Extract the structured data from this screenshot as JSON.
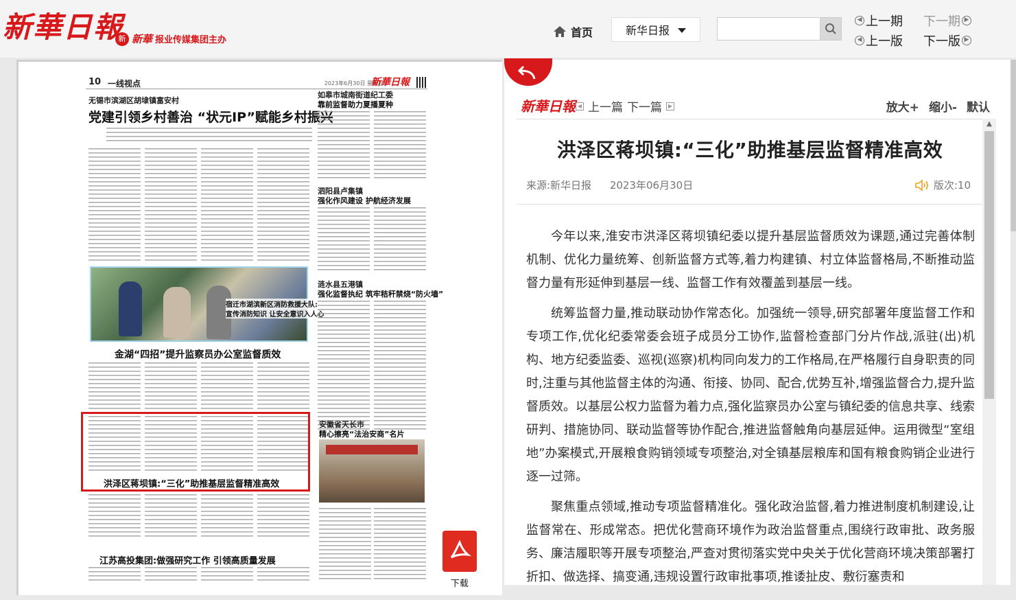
{
  "header": {
    "logo": "新華日報",
    "group_emblem": "新",
    "group_brand": "新華",
    "group_host": "报业传媒集团主办",
    "home_label": "首页",
    "paper_select": "新华日报",
    "search_placeholder": "",
    "prev_issue": "上一期",
    "next_issue": "下一期",
    "prev_page": "上一版",
    "next_page": "下一版"
  },
  "newspaper": {
    "page_number": "10",
    "section": "一线视点",
    "date_line": "2023年6月30日 星期五",
    "masthead": "新華日報",
    "lead_kicker": "无锡市滨湖区胡埭镇富安村",
    "lead_headline": "党建引领乡村善治 “状元IP”赋能乡村振兴",
    "photo_caption_1": "宿迁市湖滨新区消防救援大队:",
    "photo_caption_2": "宣传消防知识 让安全意识入人心",
    "right_kicker_1": "如皋市城南街道纪工委",
    "right_head_1": "靠前监督助力夏播夏种",
    "right_kicker_2": "泗阳县卢集镇",
    "right_head_2": "强化作风建设 护航经济发展",
    "right_kicker_3": "涟水县五港镇",
    "right_head_3": "强化监督执纪 筑牢秸秆禁烧“防火墙”",
    "mid_headline": "金湖“四招”提升监察员办公室监督质效",
    "highlight_headline": "洪泽区蒋坝镇:“三化”助推基层监督精准高效",
    "right_kicker_4": "安徽省天长市",
    "right_head_4": "精心擦亮“法治安商”名片",
    "bottom_headline": "江苏高投集团:做强研究工作 引领高质量发展"
  },
  "download": {
    "label": "下载"
  },
  "panel": {
    "logo": "新華日報",
    "prev_article": "上一篇",
    "next_article": "下一篇",
    "zoom_in": "放大+",
    "zoom_out": "缩小-",
    "zoom_default": "默认"
  },
  "article": {
    "title": "洪泽区蒋坝镇:“三化”助推基层监督精准高效",
    "source": "来源:新华日报",
    "date": "2023年06月30日",
    "page": "版次:10",
    "paragraphs": [
      "今年以来,淮安市洪泽区蒋坝镇纪委以提升基层监督质效为课题,通过完善体制机制、优化力量统筹、创新监督方式等,着力构建镇、村立体监督格局,不断推动监督力量有形延伸到基层一线、监督工作有效覆盖到基层一线。",
      "统筹监督力量,推动联动协作常态化。加强统一领导,研究部署年度监督工作和专项工作,优化纪委常委会班子成员分工协作,监督检查部门分片作战,派驻(出)机构、地方纪委监委、巡视(巡察)机构同向发力的工作格局,在严格履行自身职责的同时,注重与其他监督主体的沟通、衔接、协同、配合,优势互补,增强监督合力,提升监督质效。以基层公权力监督为着力点,强化监察员办公室与镇纪委的信息共享、线索研判、措施协同、联动监督等协作配合,推进监督触角向基层延伸。运用微型“室组地”办案模式,开展粮食购销领域专项整治,对全镇基层粮库和国有粮食购销企业进行逐一过筛。",
      "聚焦重点领域,推动专项监督精准化。强化政治监督,着力推进制度机制建设,让监督常在、形成常态。把优化营商环境作为政治监督重点,围绕行政审批、政务服务、廉洁履职等开展专项整治,严查对贯彻落实党中央关于优化营商环境决策部署打折扣、做选择、搞变通,违规设置行政审批事项,推诿扯皮、敷衍塞责和"
    ]
  }
}
